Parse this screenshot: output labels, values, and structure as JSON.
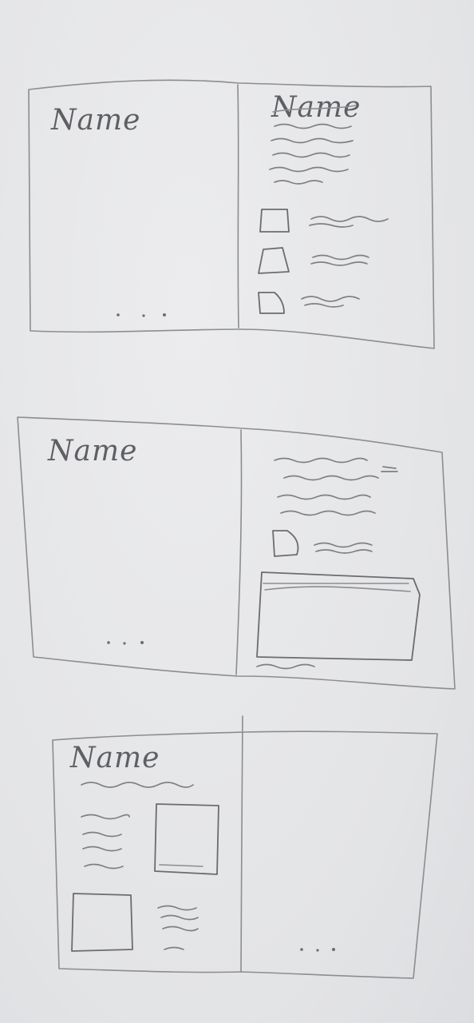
{
  "sketches": [
    {
      "left_title": "Name",
      "right_title": "Name"
    },
    {
      "left_title": "Name"
    },
    {
      "left_title": "Name"
    }
  ],
  "glyphs": {
    "ellipsis": "..."
  }
}
